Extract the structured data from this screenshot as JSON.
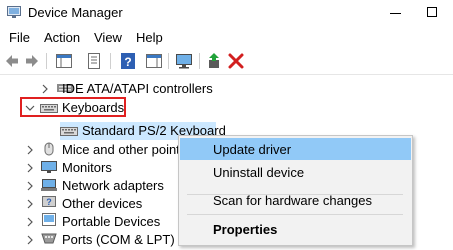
{
  "window": {
    "title": "Device Manager"
  },
  "menu": [
    "File",
    "Action",
    "View",
    "Help"
  ],
  "toolbar": {
    "buttons": [
      "back-icon",
      "forward-icon",
      "show-hide-tree-icon",
      "properties-icon",
      "help-icon",
      "action-pane-icon",
      "scan-monitor-icon",
      "update-driver-icon",
      "uninstall-icon"
    ]
  },
  "tree": {
    "items": [
      {
        "label": "IDE ATA/ATAPI controllers",
        "icon": "ide-controller-icon",
        "expanded": false
      },
      {
        "label": "Keyboards",
        "icon": "keyboard-icon",
        "expanded": true
      },
      {
        "label": "Standard PS/2 Keyboard",
        "icon": "keyboard-icon",
        "child": true,
        "selected": true
      },
      {
        "label": "Mice and other pointi",
        "icon": "mouse-icon",
        "expanded": false
      },
      {
        "label": "Monitors",
        "icon": "monitor-icon",
        "expanded": false
      },
      {
        "label": "Network adapters",
        "icon": "network-adapter-icon",
        "expanded": false
      },
      {
        "label": "Other devices",
        "icon": "other-devices-icon",
        "expanded": false
      },
      {
        "label": "Portable Devices",
        "icon": "portable-devices-icon",
        "expanded": false
      },
      {
        "label": "Ports (COM & LPT)",
        "icon": "ports-icon",
        "expanded": false
      }
    ]
  },
  "context_menu": {
    "update_driver": "Update driver",
    "uninstall_device": "Uninstall device",
    "scan_hardware": "Scan for hardware changes",
    "properties": "Properties"
  },
  "colors": {
    "highlight_box": "#e02020",
    "selection": "#cce8ff",
    "menu_hover": "#91c9f7"
  }
}
